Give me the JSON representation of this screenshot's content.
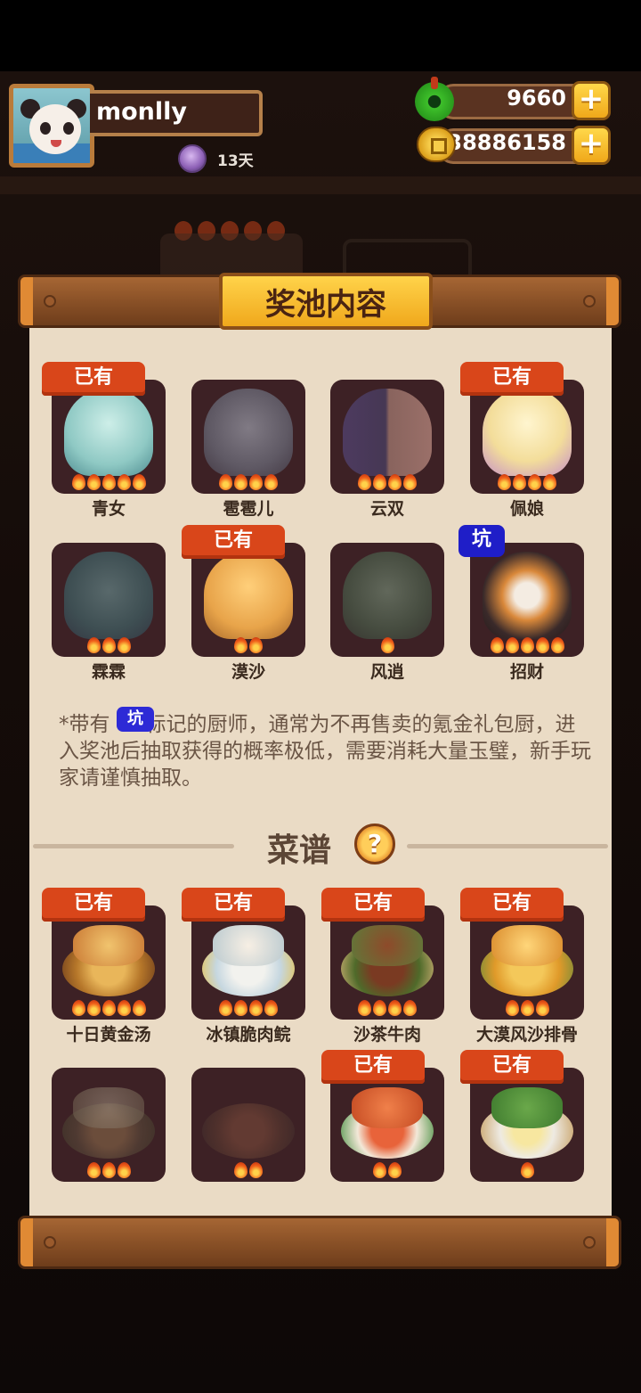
{
  "player": {
    "name": "monlly",
    "days": "13天"
  },
  "currency": {
    "jade": "9660",
    "coins": "38886158"
  },
  "panel": {
    "title": "奖池内容"
  },
  "badges": {
    "have": "已有",
    "pit": "坑"
  },
  "chefs": [
    {
      "name": "青女",
      "flames": 5,
      "owned": true,
      "pit": false
    },
    {
      "name": "雹雹儿",
      "flames": 4,
      "owned": false,
      "pit": false
    },
    {
      "name": "云双",
      "flames": 4,
      "owned": false,
      "pit": false
    },
    {
      "name": "佩娘",
      "flames": 4,
      "owned": true,
      "pit": false
    },
    {
      "name": "霖霖",
      "flames": 3,
      "owned": false,
      "pit": false
    },
    {
      "name": "漠沙",
      "flames": 2,
      "owned": true,
      "pit": false
    },
    {
      "name": "风逍",
      "flames": 1,
      "owned": false,
      "pit": false
    },
    {
      "name": "招财",
      "flames": 5,
      "owned": false,
      "pit": true
    }
  ],
  "note": {
    "prefix": "*带有",
    "suffix": "标记的厨师，通常为不再售卖的氪金礼包厨，进入奖池后抽取获得的概率极低，需要消耗大量玉璧，新手玩家请谨慎抽取。"
  },
  "recipes_section": {
    "title": "菜谱",
    "help": "?"
  },
  "recipes": [
    {
      "name": "十日黄金汤",
      "flames": 5,
      "owned": true
    },
    {
      "name": "冰镇脆肉鲩",
      "flames": 4,
      "owned": true
    },
    {
      "name": "沙茶牛肉",
      "flames": 4,
      "owned": true
    },
    {
      "name": "大漠风沙排骨",
      "flames": 3,
      "owned": true
    },
    {
      "name": "",
      "flames": 3,
      "owned": false
    },
    {
      "name": "",
      "flames": 2,
      "owned": false
    },
    {
      "name": "",
      "flames": 2,
      "owned": true
    },
    {
      "name": "",
      "flames": 1,
      "owned": true
    }
  ],
  "colors": {
    "badge_have": "#d9461a",
    "badge_pit": "#1f1ec8",
    "paper": "#eadbc5",
    "card": "#3d2125"
  }
}
